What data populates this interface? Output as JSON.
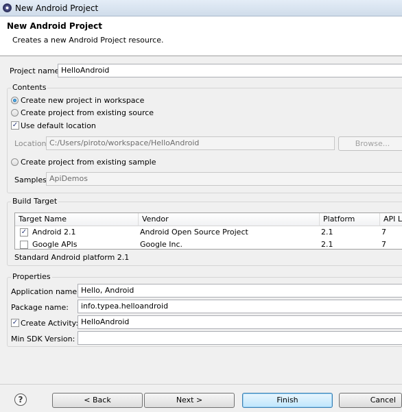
{
  "window": {
    "title": "New Android Project"
  },
  "banner": {
    "title": "New Android Project",
    "description": "Creates a new Android Project resource."
  },
  "project_name": {
    "label": "Project name:",
    "value": "HelloAndroid"
  },
  "contents": {
    "label": "Contents",
    "option_new": "Create new project in workspace",
    "option_existing_source": "Create project from existing source",
    "use_default_location": "Use default location",
    "location_label": "Location:",
    "location_value": "C:/Users/piroto/workspace/HelloAndroid",
    "browse_label": "Browse...",
    "option_existing_sample": "Create project from existing sample",
    "samples_label": "Samples:",
    "samples_value": "ApiDemos"
  },
  "build_target": {
    "label": "Build Target",
    "columns": [
      "Target Name",
      "Vendor",
      "Platform",
      "API Le"
    ],
    "rows": [
      {
        "checked": true,
        "name": "Android 2.1",
        "vendor": "Android Open Source Project",
        "platform": "2.1",
        "api": "7"
      },
      {
        "checked": false,
        "name": "Google APIs",
        "vendor": "Google Inc.",
        "platform": "2.1",
        "api": "7"
      }
    ],
    "status": "Standard Android platform 2.1"
  },
  "properties": {
    "label": "Properties",
    "app_name_label": "Application name:",
    "app_name_value": "Hello, Android",
    "package_label": "Package name:",
    "package_value": "info.typea.helloandroid",
    "create_activity_label": "Create Activity:",
    "create_activity_value": "HelloAndroid",
    "min_sdk_label": "Min SDK Version:",
    "min_sdk_value": ""
  },
  "buttons": {
    "help": "?",
    "back": "< Back",
    "next": "Next >",
    "finish": "Finish",
    "cancel": "Cancel"
  }
}
